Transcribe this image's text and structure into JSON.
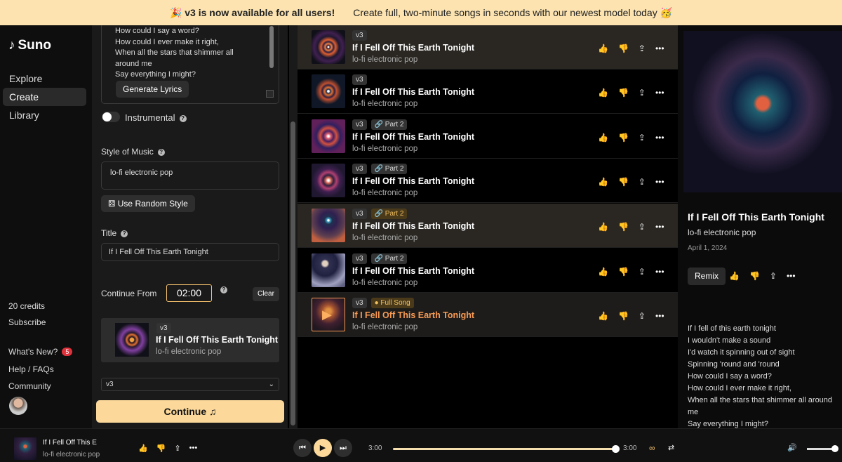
{
  "banner": {
    "bold": "🎉 v3 is now available for all users!",
    "text": "Create full, two-minute songs in seconds with our newest model today 🥳"
  },
  "sidebar": {
    "logo": "Suno",
    "nav": [
      {
        "label": "Explore"
      },
      {
        "label": "Create"
      },
      {
        "label": "Library"
      }
    ],
    "credits": "20 credits",
    "subscribe": "Subscribe",
    "whats_new": "What's New?",
    "whats_new_count": "5",
    "help": "Help / FAQs",
    "community": "Community"
  },
  "create": {
    "lyrics": "How could I say a word?\nHow could I ever make it right,\nWhen all the stars that shimmer all around me\nSay everything I might?",
    "generate_lyrics": "Generate Lyrics",
    "instrumental": "Instrumental",
    "style_label": "Style of Music",
    "style_value": "lo-fi electronic pop",
    "random_style": "Use Random Style",
    "title_label": "Title",
    "title_value": "If I Fell Off This Earth Tonight",
    "continue_from_label": "Continue From",
    "continue_from_value": "02:00",
    "clear": "Clear",
    "card": {
      "tag": "v3",
      "title": "If I Fell Off This Earth Tonight",
      "style": "lo-fi electronic pop"
    },
    "model": "v3",
    "continue_button": "Continue"
  },
  "songs": [
    {
      "tags": [
        "v3"
      ],
      "title": "If I Fell Off This Earth Tonight",
      "style": "lo-fi electronic pop",
      "liked": true
    },
    {
      "tags": [
        "v3"
      ],
      "title": "If I Fell Off This Earth Tonight",
      "style": "lo-fi electronic pop"
    },
    {
      "tags": [
        "v3",
        "Part 2"
      ],
      "title": "If I Fell Off This Earth Tonight",
      "style": "lo-fi electronic pop"
    },
    {
      "tags": [
        "v3",
        "Part 2"
      ],
      "title": "If I Fell Off This Earth Tonight",
      "style": "lo-fi electronic pop"
    },
    {
      "tags": [
        "v3",
        "Part 2"
      ],
      "title": "If I Fell Off This Earth Tonight",
      "style": "lo-fi electronic pop"
    },
    {
      "tags": [
        "v3",
        "Part 2"
      ],
      "title": "If I Fell Off This Earth Tonight",
      "style": "lo-fi electronic pop"
    },
    {
      "tags": [
        "v3",
        "Full Song"
      ],
      "title": "If I Fell Off This Earth Tonight",
      "style": "lo-fi electronic pop",
      "playing": true
    }
  ],
  "detail": {
    "title": "If I Fell Off This Earth Tonight",
    "style": "lo-fi electronic pop",
    "date": "April 1, 2024",
    "remix": "Remix",
    "lyrics": "If I fell of this earth tonight\nI wouldn't make a sound\nI'd watch it spinning out of sight\nSpinning 'round and 'round\nHow could I say a word?\nHow could I ever make it right,\nWhen all the stars that shimmer all around me\nSay everything I might?"
  },
  "player": {
    "title": "If I Fell Off This E",
    "style": "lo-fi electronic pop",
    "elapsed": "3:00",
    "duration": "3:00",
    "progress": 1.0
  }
}
